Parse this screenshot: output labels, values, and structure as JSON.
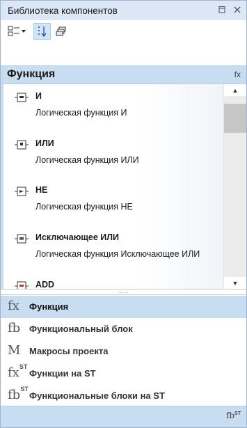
{
  "window": {
    "title": "Библиотека компонентов",
    "pin_icon": "pin-icon",
    "close_icon": "close-icon"
  },
  "toolbar": {
    "view_mode_icon": "list-view-icon",
    "sort_icon": "sort-icon",
    "collapse_icon": "stack-icon"
  },
  "category_header": {
    "title": "Функция",
    "tag": "fx"
  },
  "items": [
    {
      "name": "И",
      "description": "Логическая функция И"
    },
    {
      "name": "ИЛИ",
      "description": "Логическая функция ИЛИ"
    },
    {
      "name": "НЕ",
      "description": "Логическая функция НЕ"
    },
    {
      "name": "Исключающее ИЛИ",
      "description": "Логическая функция Исключающее ИЛИ"
    },
    {
      "name": "ADD",
      "description": ""
    }
  ],
  "scrollbar": {
    "position": 0.05,
    "visible_fraction": 0.16
  },
  "splitter": {
    "grip": "....."
  },
  "categories": [
    {
      "icon": "fx",
      "sup": "",
      "label": "Функция",
      "selected": true
    },
    {
      "icon": "fb",
      "sup": "",
      "label": "Функциональный блок",
      "selected": false
    },
    {
      "icon": "M",
      "sup": "",
      "label": "Макросы проекта",
      "selected": false
    },
    {
      "icon": "fx",
      "sup": "ST",
      "label": "Функции на ST",
      "selected": false
    },
    {
      "icon": "fb",
      "sup": "ST",
      "label": "Функциональные блоки на ST",
      "selected": false
    }
  ],
  "bottom_bar": {
    "button": "fb",
    "button_sup": "ST"
  },
  "colors": {
    "accent": "#c9ddf1",
    "titlebar": "#dbe7f4"
  }
}
